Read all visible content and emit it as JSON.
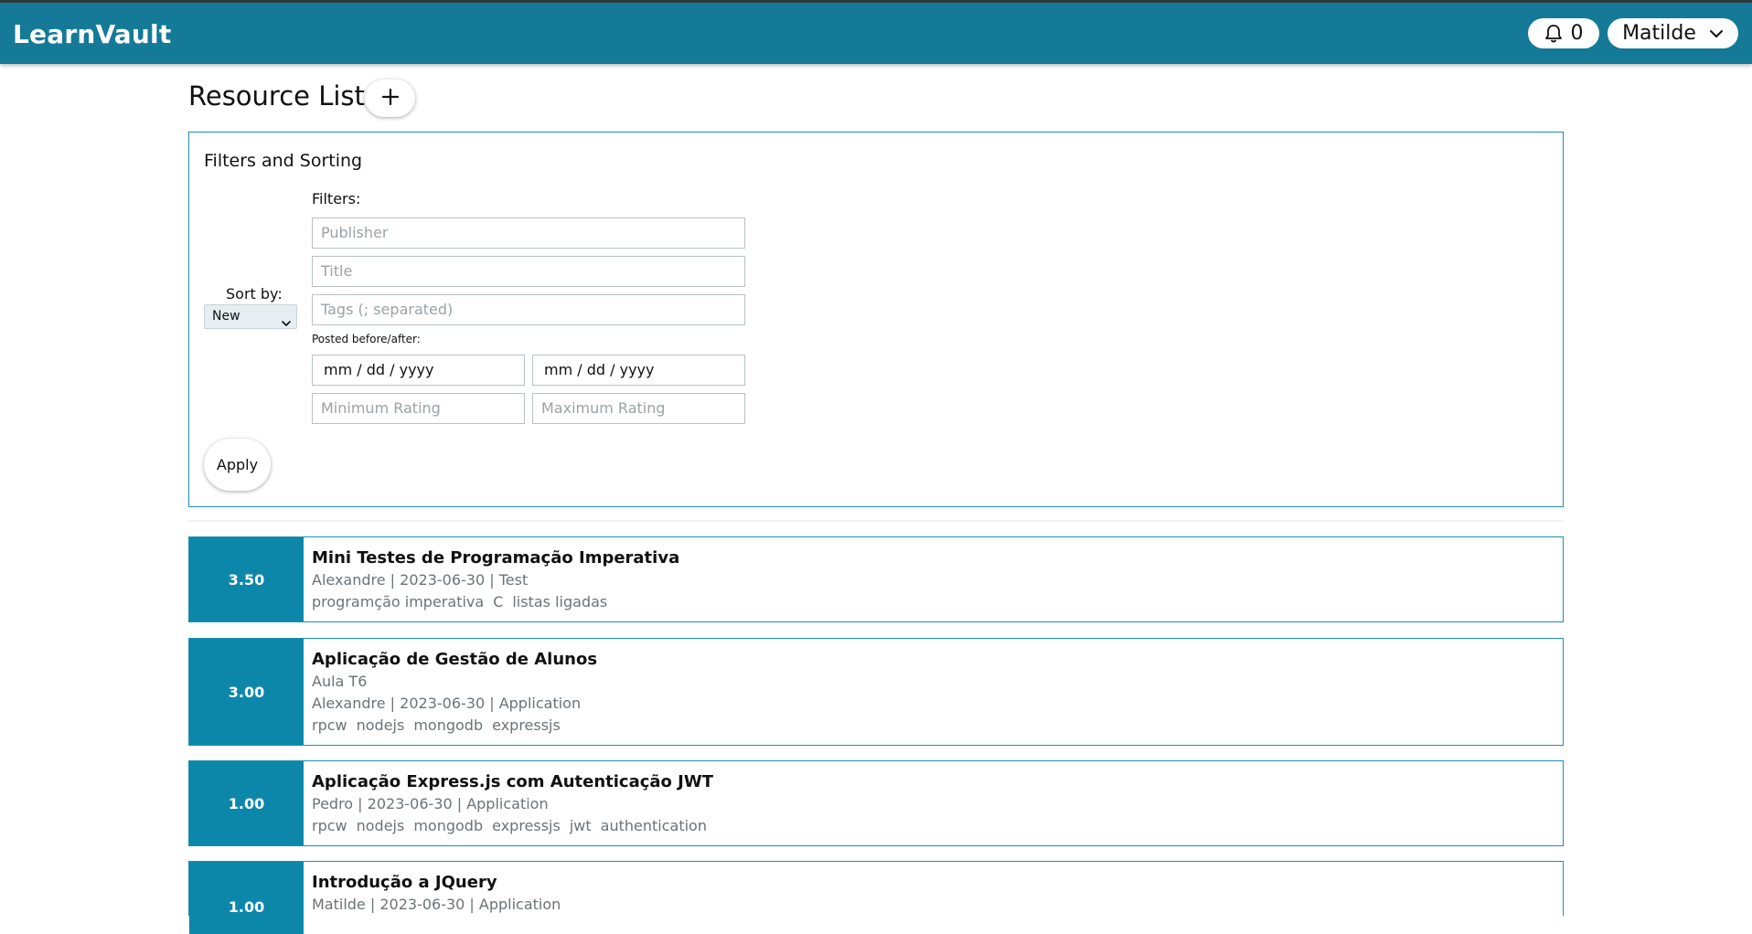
{
  "navbar": {
    "brand": "LearnVault",
    "notifications_count": "0",
    "user_name": "Matilde"
  },
  "page": {
    "title": "Resource List"
  },
  "filters": {
    "card_title": "Filters and Sorting",
    "sort_label": "Sort by:",
    "sort_value": "New",
    "filters_label": "Filters:",
    "publisher_placeholder": "Publisher",
    "title_placeholder": "Title",
    "tags_placeholder": "Tags (; separated)",
    "posted_label": "Posted before/after:",
    "date_before": "mm / dd / yyyy",
    "date_after": "mm / dd / yyyy",
    "min_rating_placeholder": "Minimum Rating",
    "max_rating_placeholder": "Maximum Rating",
    "apply_label": "Apply"
  },
  "resources": [
    {
      "rating": "3.50",
      "title": "Mini Testes de Programação Imperativa",
      "subtitle": "",
      "meta": "Alexandre | 2023-06-30 | Test",
      "tags": [
        "programção imperativa",
        "C",
        "listas ligadas"
      ]
    },
    {
      "rating": "3.00",
      "title": "Aplicação de Gestão de Alunos",
      "subtitle": "Aula T6",
      "meta": "Alexandre | 2023-06-30 | Application",
      "tags": [
        "rpcw",
        "nodejs",
        "mongodb",
        "expressjs"
      ]
    },
    {
      "rating": "1.00",
      "title": "Aplicação Express.js com Autenticação JWT",
      "subtitle": "",
      "meta": "Pedro | 2023-06-30 | Application",
      "tags": [
        "rpcw",
        "nodejs",
        "mongodb",
        "expressjs",
        "jwt",
        "authentication"
      ]
    },
    {
      "rating": "1.00",
      "title": "Introdução a JQuery",
      "subtitle": "",
      "meta": "Matilde | 2023-06-30 | Application",
      "tags": []
    }
  ],
  "colors": {
    "navbar": "#147a97",
    "rating_box": "#0d87a9",
    "card_border": "#1f8fb0"
  },
  "icons": {
    "notifications": "bell-icon",
    "user_menu": "chevron-down-icon",
    "add": "plus-icon",
    "sort": "chevron-down-icon"
  }
}
